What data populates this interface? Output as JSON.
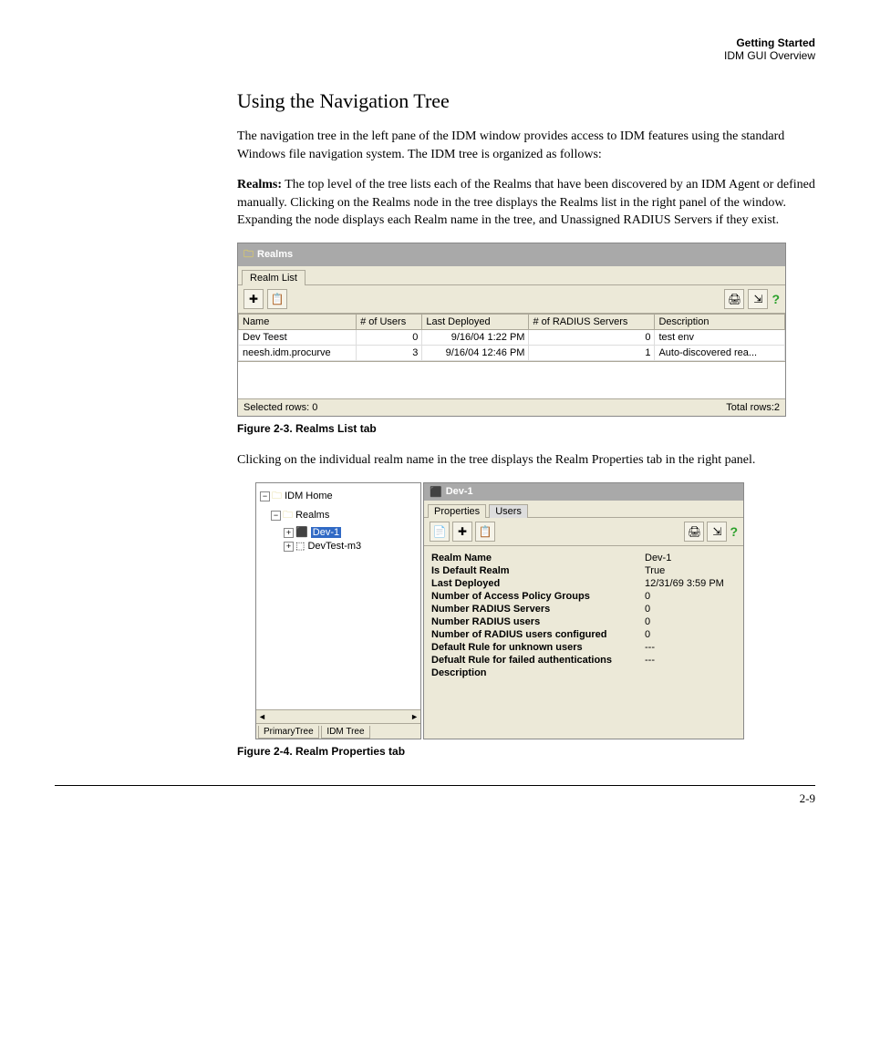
{
  "header": {
    "title": "Getting Started",
    "subtitle": "IDM GUI Overview"
  },
  "section_heading": "Using the Navigation Tree",
  "para1": "The navigation tree in the left pane of the IDM window provides access to IDM features using the standard Windows file navigation system. The IDM tree is organized as follows:",
  "para2_label": "Realms:",
  "para2_text": " The top level of the tree lists each of the Realms that have been discovered by an IDM Agent or defined manually. Clicking on the Realms node in the tree displays the Realms list in the right panel of the window. Expanding the node displays each Realm name in the tree, and Unassigned RADIUS Servers if they exist.",
  "fig1": {
    "title": "Realms",
    "tab": "Realm List",
    "help": "?",
    "columns": [
      "Name",
      "# of Users",
      "Last Deployed",
      "# of RADIUS Servers",
      "Description"
    ],
    "rows": [
      {
        "name": "Dev Teest",
        "users": "0",
        "deployed": "9/16/04 1:22 PM",
        "servers": "0",
        "desc": "test env"
      },
      {
        "name": "neesh.idm.procurve",
        "users": "3",
        "deployed": "9/16/04 12:46 PM",
        "servers": "1",
        "desc": "Auto-discovered rea..."
      }
    ],
    "status_left": "Selected rows: 0",
    "status_right": "Total rows:2"
  },
  "figcap1": "Figure 2-3. Realms List tab",
  "para3": "Clicking on the individual realm name in the tree displays the Realm Properties tab in the right panel.",
  "fig2": {
    "tree": {
      "root": "IDM Home",
      "realms": "Realms",
      "dev1": "Dev-1",
      "devtest": "DevTest-m3",
      "tab_primary": "PrimaryTree",
      "tab_idm": "IDM Tree",
      "scroll_left": "◄",
      "scroll_right": "►"
    },
    "panel": {
      "title": "Dev-1",
      "tab_props": "Properties",
      "tab_users": "Users",
      "help": "?",
      "props": [
        {
          "k": "Realm Name",
          "v": "Dev-1"
        },
        {
          "k": "Is Default Realm",
          "v": "True"
        },
        {
          "k": "Last Deployed",
          "v": "12/31/69 3:59 PM"
        },
        {
          "k": "Number of Access Policy Groups",
          "v": "0"
        },
        {
          "k": "Number RADIUS Servers",
          "v": "0"
        },
        {
          "k": "Number RADIUS users",
          "v": "0"
        },
        {
          "k": "Number of RADIUS users configured",
          "v": "0"
        },
        {
          "k": "Default Rule for unknown users",
          "v": "---"
        },
        {
          "k": "Defualt Rule for failed authentications",
          "v": "---"
        },
        {
          "k": "Description",
          "v": ""
        }
      ]
    }
  },
  "figcap2": "Figure 2-4. Realm Properties tab",
  "pagenum": "2-9"
}
